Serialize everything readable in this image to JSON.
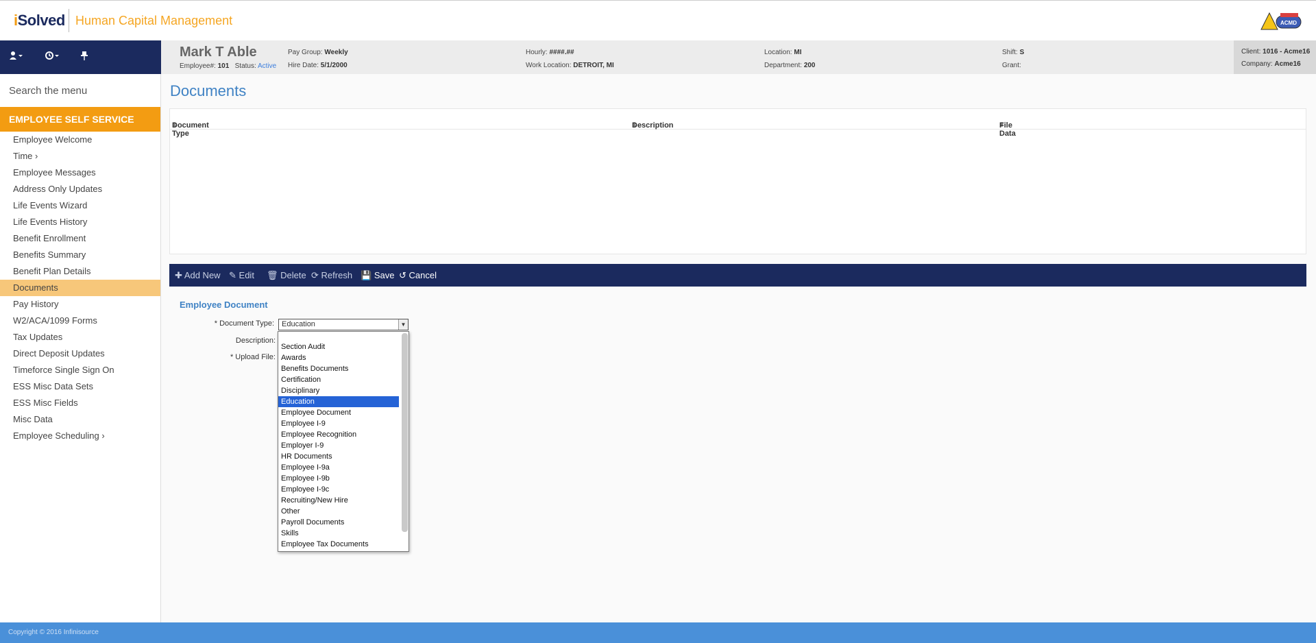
{
  "header": {
    "logo_i": "i",
    "logo_rest": "Solved",
    "app_title": "Human Capital Management",
    "badge_text": "ACMD"
  },
  "sidebar": {
    "search_label": "Search the menu",
    "section": "EMPLOYEE SELF SERVICE",
    "items": [
      {
        "label": "Employee Welcome"
      },
      {
        "label": "Time  ›"
      },
      {
        "label": "Employee Messages"
      },
      {
        "label": "Address Only Updates"
      },
      {
        "label": "Life Events Wizard"
      },
      {
        "label": "Life Events History"
      },
      {
        "label": "Benefit Enrollment"
      },
      {
        "label": "Benefits Summary"
      },
      {
        "label": "Benefit Plan Details"
      },
      {
        "label": "Documents"
      },
      {
        "label": "Pay History"
      },
      {
        "label": "W2/ACA/1099 Forms"
      },
      {
        "label": "Tax Updates"
      },
      {
        "label": "Direct Deposit Updates"
      },
      {
        "label": "Timeforce Single Sign On"
      },
      {
        "label": "ESS Misc Data Sets"
      },
      {
        "label": "ESS Misc Fields"
      },
      {
        "label": "Misc Data"
      },
      {
        "label": "Employee Scheduling  ›"
      }
    ]
  },
  "employee": {
    "name": "Mark T Able",
    "number_label": "Employee#:",
    "number": "101",
    "status_label": "Status:",
    "status": "Active",
    "pay_group_label": "Pay Group:",
    "pay_group": "Weekly",
    "hire_date_label": "Hire Date:",
    "hire_date": "5/1/2000",
    "hourly_label": "Hourly:",
    "hourly": "####.##",
    "work_location_label": "Work Location:",
    "work_location": "DETROIT, MI",
    "location_label": "Location:",
    "location": "MI",
    "department_label": "Department:",
    "department": "200",
    "shift_label": "Shift:",
    "shift": "S",
    "grant_label": "Grant:",
    "client_label": "Client:",
    "client": "1016 - Acme16",
    "company_label": "Company:",
    "company": "Acme16"
  },
  "main": {
    "title": "Documents",
    "columns": [
      "Document Type",
      "Description",
      "File Data"
    ]
  },
  "toolbar": {
    "add_new": "Add New",
    "edit": "Edit",
    "delete": "Delete",
    "refresh": "Refresh",
    "save": "Save",
    "cancel": "Cancel"
  },
  "form": {
    "title": "Employee Document",
    "doc_type_label": "* Document Type:",
    "description_label": "Description:",
    "upload_label": "* Upload File:",
    "doc_type_value": "Education",
    "options": [
      "Section Audit",
      "Awards",
      "Benefits Documents",
      "Certification",
      "Disciplinary",
      "Education",
      "Employee Document",
      "Employee I-9",
      "Employee Recognition",
      "Employer I-9",
      "HR Documents",
      "Employee I-9a",
      "Employee I-9b",
      "Employee I-9c",
      "Recruiting/New Hire",
      "Other",
      "Payroll Documents",
      "Skills",
      "Employee Tax Documents"
    ]
  },
  "footer": {
    "copyright": "Copyright © 2016 Infinisource"
  },
  "colors": {
    "navy": "#1b2a5e",
    "orange": "#f39c12",
    "link_blue": "#3f82c4",
    "selection": "#2563d6"
  }
}
